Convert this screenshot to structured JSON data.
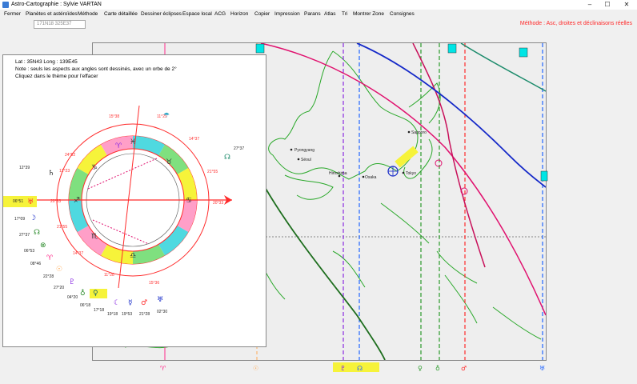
{
  "window": {
    "title": "Astro-Cartographie : Sylvie VARTAN"
  },
  "menu": [
    "Fermer",
    "Planètes et astéroïdes",
    "Méthode",
    "Carte détaillée",
    "Dessiner éclipses",
    "Espace local",
    "ACG",
    "Horizon",
    "Copier",
    "Impression",
    "Parans",
    "Atlas",
    "Tri",
    "Montrer Zone",
    "Consignes"
  ],
  "coords": "171N18    325E37",
  "method_note": "Méthode : Asc, droites et déclinaisons réelles",
  "panel": {
    "line1": "Lat : 35N43    Long : 139E45",
    "line2": "Note : seuls les aspects aux angles sont dessinés, avec un orbe de 2°",
    "line3": "Cliquez dans le thème pour l'effacer"
  },
  "cities": [
    "Pyongyang",
    "Séoul",
    "Sapporo",
    "Tokyo",
    "Hiroshima",
    "Osaka"
  ],
  "ring_labels": [
    "15°38",
    "11°29",
    "14°37",
    "21°55",
    "20°33",
    "15°36",
    "11°28",
    "14°37",
    "21°55",
    "20°33",
    "24°52",
    "12°23"
  ],
  "planet_degrees": [
    "27°37",
    "12°39",
    "06°51",
    "17°09",
    "27°37",
    "06°53",
    "08°46",
    "22°28",
    "27°20",
    "04°20",
    "06°18",
    "17°18",
    "19°18",
    "19°53",
    "21°28",
    "02°30"
  ],
  "bottom_glyphs": [
    "♈",
    "☉",
    "♇",
    "☊",
    "♀",
    "♁",
    "♂",
    "♅"
  ],
  "colors": {
    "accent": "#ff2a2a",
    "highlight": "#f6f33a"
  }
}
